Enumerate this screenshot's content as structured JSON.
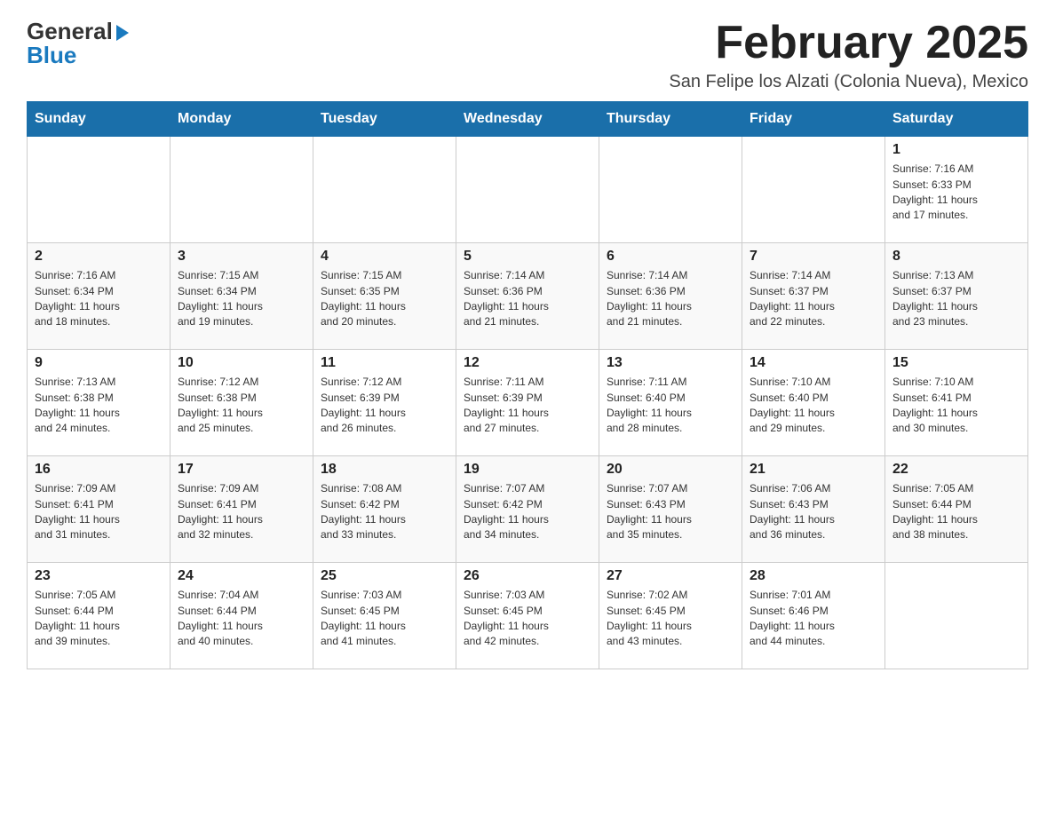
{
  "logo": {
    "line1": "General",
    "arrow": "▶",
    "line2": "Blue"
  },
  "title": "February 2025",
  "subtitle": "San Felipe los Alzati (Colonia Nueva), Mexico",
  "days_of_week": [
    "Sunday",
    "Monday",
    "Tuesday",
    "Wednesday",
    "Thursday",
    "Friday",
    "Saturday"
  ],
  "weeks": [
    [
      {
        "day": "",
        "info": ""
      },
      {
        "day": "",
        "info": ""
      },
      {
        "day": "",
        "info": ""
      },
      {
        "day": "",
        "info": ""
      },
      {
        "day": "",
        "info": ""
      },
      {
        "day": "",
        "info": ""
      },
      {
        "day": "1",
        "info": "Sunrise: 7:16 AM\nSunset: 6:33 PM\nDaylight: 11 hours\nand 17 minutes."
      }
    ],
    [
      {
        "day": "2",
        "info": "Sunrise: 7:16 AM\nSunset: 6:34 PM\nDaylight: 11 hours\nand 18 minutes."
      },
      {
        "day": "3",
        "info": "Sunrise: 7:15 AM\nSunset: 6:34 PM\nDaylight: 11 hours\nand 19 minutes."
      },
      {
        "day": "4",
        "info": "Sunrise: 7:15 AM\nSunset: 6:35 PM\nDaylight: 11 hours\nand 20 minutes."
      },
      {
        "day": "5",
        "info": "Sunrise: 7:14 AM\nSunset: 6:36 PM\nDaylight: 11 hours\nand 21 minutes."
      },
      {
        "day": "6",
        "info": "Sunrise: 7:14 AM\nSunset: 6:36 PM\nDaylight: 11 hours\nand 21 minutes."
      },
      {
        "day": "7",
        "info": "Sunrise: 7:14 AM\nSunset: 6:37 PM\nDaylight: 11 hours\nand 22 minutes."
      },
      {
        "day": "8",
        "info": "Sunrise: 7:13 AM\nSunset: 6:37 PM\nDaylight: 11 hours\nand 23 minutes."
      }
    ],
    [
      {
        "day": "9",
        "info": "Sunrise: 7:13 AM\nSunset: 6:38 PM\nDaylight: 11 hours\nand 24 minutes."
      },
      {
        "day": "10",
        "info": "Sunrise: 7:12 AM\nSunset: 6:38 PM\nDaylight: 11 hours\nand 25 minutes."
      },
      {
        "day": "11",
        "info": "Sunrise: 7:12 AM\nSunset: 6:39 PM\nDaylight: 11 hours\nand 26 minutes."
      },
      {
        "day": "12",
        "info": "Sunrise: 7:11 AM\nSunset: 6:39 PM\nDaylight: 11 hours\nand 27 minutes."
      },
      {
        "day": "13",
        "info": "Sunrise: 7:11 AM\nSunset: 6:40 PM\nDaylight: 11 hours\nand 28 minutes."
      },
      {
        "day": "14",
        "info": "Sunrise: 7:10 AM\nSunset: 6:40 PM\nDaylight: 11 hours\nand 29 minutes."
      },
      {
        "day": "15",
        "info": "Sunrise: 7:10 AM\nSunset: 6:41 PM\nDaylight: 11 hours\nand 30 minutes."
      }
    ],
    [
      {
        "day": "16",
        "info": "Sunrise: 7:09 AM\nSunset: 6:41 PM\nDaylight: 11 hours\nand 31 minutes."
      },
      {
        "day": "17",
        "info": "Sunrise: 7:09 AM\nSunset: 6:41 PM\nDaylight: 11 hours\nand 32 minutes."
      },
      {
        "day": "18",
        "info": "Sunrise: 7:08 AM\nSunset: 6:42 PM\nDaylight: 11 hours\nand 33 minutes."
      },
      {
        "day": "19",
        "info": "Sunrise: 7:07 AM\nSunset: 6:42 PM\nDaylight: 11 hours\nand 34 minutes."
      },
      {
        "day": "20",
        "info": "Sunrise: 7:07 AM\nSunset: 6:43 PM\nDaylight: 11 hours\nand 35 minutes."
      },
      {
        "day": "21",
        "info": "Sunrise: 7:06 AM\nSunset: 6:43 PM\nDaylight: 11 hours\nand 36 minutes."
      },
      {
        "day": "22",
        "info": "Sunrise: 7:05 AM\nSunset: 6:44 PM\nDaylight: 11 hours\nand 38 minutes."
      }
    ],
    [
      {
        "day": "23",
        "info": "Sunrise: 7:05 AM\nSunset: 6:44 PM\nDaylight: 11 hours\nand 39 minutes."
      },
      {
        "day": "24",
        "info": "Sunrise: 7:04 AM\nSunset: 6:44 PM\nDaylight: 11 hours\nand 40 minutes."
      },
      {
        "day": "25",
        "info": "Sunrise: 7:03 AM\nSunset: 6:45 PM\nDaylight: 11 hours\nand 41 minutes."
      },
      {
        "day": "26",
        "info": "Sunrise: 7:03 AM\nSunset: 6:45 PM\nDaylight: 11 hours\nand 42 minutes."
      },
      {
        "day": "27",
        "info": "Sunrise: 7:02 AM\nSunset: 6:45 PM\nDaylight: 11 hours\nand 43 minutes."
      },
      {
        "day": "28",
        "info": "Sunrise: 7:01 AM\nSunset: 6:46 PM\nDaylight: 11 hours\nand 44 minutes."
      },
      {
        "day": "",
        "info": ""
      }
    ]
  ]
}
